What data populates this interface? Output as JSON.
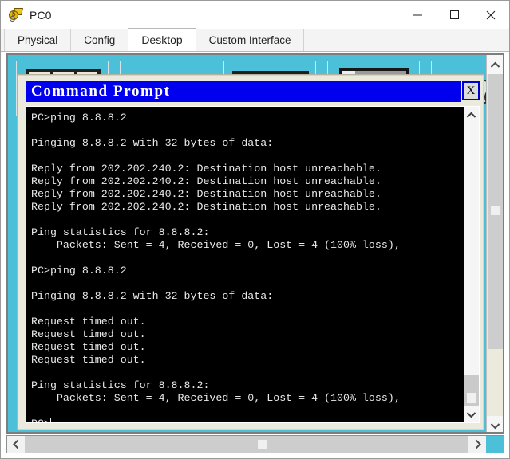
{
  "window": {
    "title": "PC0",
    "icon": "packet-tracer-pc-icon",
    "controls": {
      "minimize": "minimize-icon",
      "maximize": "maximize-icon",
      "close": "close-icon"
    }
  },
  "tabs": [
    {
      "label": "Physical",
      "active": false
    },
    {
      "label": "Config",
      "active": false
    },
    {
      "label": "Desktop",
      "active": true
    },
    {
      "label": "Custom Interface",
      "active": false
    }
  ],
  "desktop": {
    "background_color": "#4cc0d8",
    "tiles": [
      {
        "icon": "ip-configuration-icon"
      },
      {
        "icon": "dial-up-icon"
      },
      {
        "icon": "terminal-icon"
      },
      {
        "icon": "command-prompt-icon"
      },
      {
        "icon": "web-browser-icon"
      }
    ]
  },
  "command_prompt": {
    "title": "Command Prompt",
    "close_label": "X",
    "background_color": "#000000",
    "titlebar_color": "#0000ee",
    "text_color": "#e9e9e9",
    "lines": [
      "PC>ping 8.8.8.2",
      "",
      "Pinging 8.8.8.2 with 32 bytes of data:",
      "",
      "Reply from 202.202.240.2: Destination host unreachable.",
      "Reply from 202.202.240.2: Destination host unreachable.",
      "Reply from 202.202.240.2: Destination host unreachable.",
      "Reply from 202.202.240.2: Destination host unreachable.",
      "",
      "Ping statistics for 8.8.8.2:",
      "    Packets: Sent = 4, Received = 0, Lost = 4 (100% loss),",
      "",
      "PC>ping 8.8.8.2",
      "",
      "Pinging 8.8.8.2 with 32 bytes of data:",
      "",
      "Request timed out.",
      "Request timed out.",
      "Request timed out.",
      "Request timed out.",
      "",
      "Ping statistics for 8.8.8.2:",
      "    Packets: Sent = 4, Received = 0, Lost = 4 (100% loss),",
      ""
    ],
    "prompt": "PC>",
    "scrollbar": {
      "up_arrow": "chevron-up-icon",
      "down_arrow": "chevron-down-icon"
    }
  },
  "scrollbars": {
    "desktop_vertical": {
      "up_arrow": "chevron-up-icon",
      "down_arrow": "chevron-down-icon"
    },
    "desktop_horizontal": {
      "left_arrow": "chevron-left-icon",
      "right_arrow": "chevron-right-icon"
    }
  }
}
